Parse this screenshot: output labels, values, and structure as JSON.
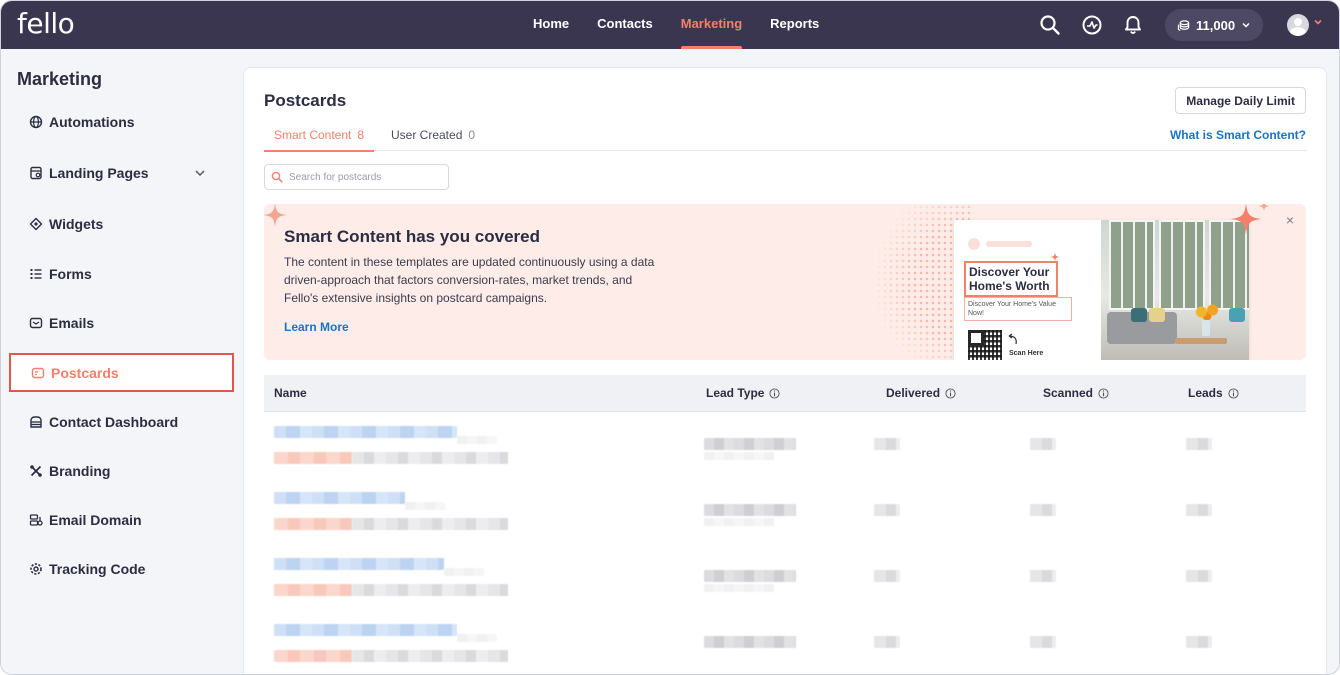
{
  "app": {
    "logo": "fello"
  },
  "nav": {
    "items": [
      {
        "label": "Home",
        "active": false
      },
      {
        "label": "Contacts",
        "active": false
      },
      {
        "label": "Marketing",
        "active": true
      },
      {
        "label": "Reports",
        "active": false
      }
    ]
  },
  "topbar": {
    "credits": "11,000",
    "icons": [
      "search-icon",
      "activity-icon",
      "bell-icon",
      "coins-icon",
      "avatar",
      "chevron-down-icon"
    ]
  },
  "sidebar": {
    "title": "Marketing",
    "items": [
      {
        "label": "Automations",
        "icon": "globe-icon"
      },
      {
        "label": "Landing Pages",
        "icon": "page-icon",
        "expandable": true
      },
      {
        "label": "Widgets",
        "icon": "widget-icon"
      },
      {
        "label": "Forms",
        "icon": "list-icon"
      },
      {
        "label": "Emails",
        "icon": "mail-icon"
      },
      {
        "label": "Postcards",
        "icon": "postcard-icon",
        "active": true
      },
      {
        "label": "Contact Dashboard",
        "icon": "dashboard-icon"
      },
      {
        "label": "Branding",
        "icon": "brush-icon"
      },
      {
        "label": "Email Domain",
        "icon": "domain-icon"
      },
      {
        "label": "Tracking Code",
        "icon": "gear-icon"
      }
    ]
  },
  "main": {
    "title": "Postcards",
    "manage_button": "Manage Daily Limit",
    "tabs": [
      {
        "label": "Smart Content",
        "count": "8",
        "active": true
      },
      {
        "label": "User Created",
        "count": "0",
        "active": false
      }
    ],
    "help_link": "What is Smart Content?",
    "search": {
      "placeholder": "Search for postcards",
      "value": ""
    }
  },
  "banner": {
    "title": "Smart Content has you covered",
    "description": "The content in these templates are updated continuously using a data driven-approach that factors conversion-rates, market trends, and Fello's extensive insights on postcard campaigns.",
    "link": "Learn More",
    "close": "×",
    "postcard": {
      "headline": "Discover Your Home's Worth",
      "subline": "Discover Your Home's Value Now!",
      "scan": "Scan Here"
    }
  },
  "table": {
    "columns": [
      {
        "label": "Name",
        "info": false
      },
      {
        "label": "Lead Type",
        "info": true
      },
      {
        "label": "Delivered",
        "info": true
      },
      {
        "label": "Scanned",
        "info": true
      },
      {
        "label": "Leads",
        "info": true
      }
    ],
    "row_count": 4
  },
  "colors": {
    "topbar": "#3a3650",
    "accent": "#f3806a",
    "link": "#1a73c8",
    "active_border": "#e1574a",
    "banner_bg": "#fdece7"
  }
}
